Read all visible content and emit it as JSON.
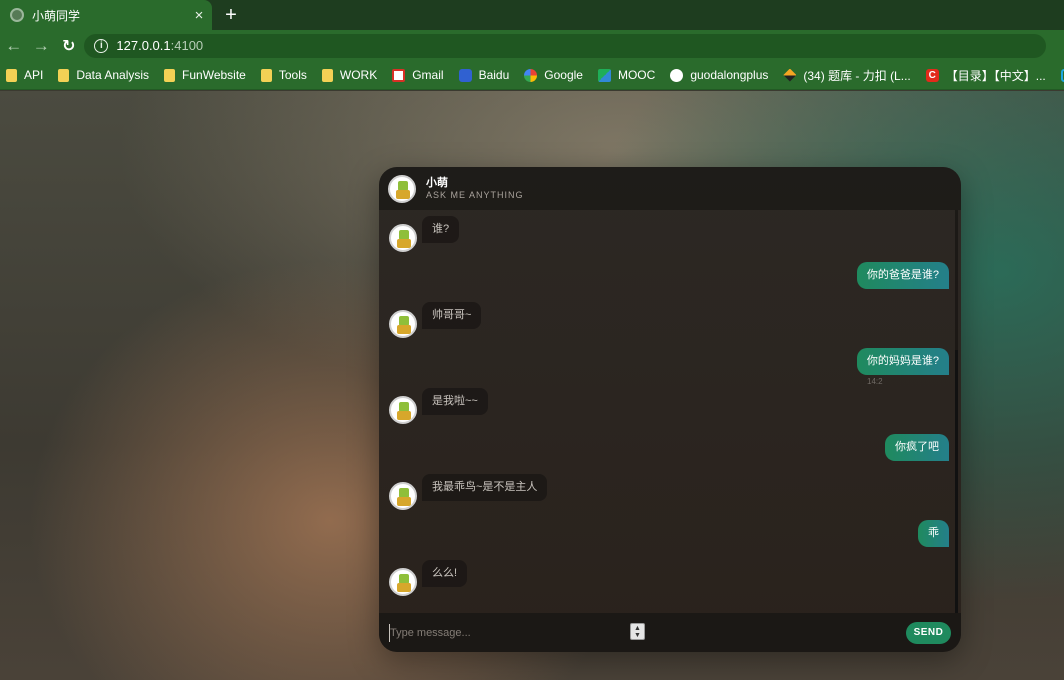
{
  "browser": {
    "tab_title": "小萌同学",
    "new_tab_label": "+",
    "tab_close_label": "×",
    "url_host": "127.0.0.1",
    "url_port": ":4100",
    "bookmarks": [
      {
        "label": "API",
        "icon": "folder-icon"
      },
      {
        "label": "Data Analysis",
        "icon": "folder-icon"
      },
      {
        "label": "FunWebsite",
        "icon": "folder-icon"
      },
      {
        "label": "Tools",
        "icon": "folder-icon"
      },
      {
        "label": "WORK",
        "icon": "folder-icon"
      },
      {
        "label": "Gmail",
        "icon": "gmail-icon"
      },
      {
        "label": "Baidu",
        "icon": "baidu-icon"
      },
      {
        "label": "Google",
        "icon": "google-icon"
      },
      {
        "label": "MOOC",
        "icon": "mooc-icon"
      },
      {
        "label": "guodalongplus",
        "icon": "github-icon"
      },
      {
        "label": "(34) 题库 - 力扣 (L...",
        "icon": "leetcode-icon"
      },
      {
        "label": "【目录】【中文】...",
        "icon": "csdn-icon"
      },
      {
        "label": "",
        "icon": "bilibili-icon"
      }
    ]
  },
  "chat": {
    "bot_name": "小萌",
    "bot_subtitle": "ASK ME ANYTHING",
    "messages": [
      {
        "from": "bot",
        "text": "谁?"
      },
      {
        "from": "user",
        "text": "你的爸爸是谁?"
      },
      {
        "from": "bot",
        "text": "帅哥哥~"
      },
      {
        "from": "user",
        "text": "你的妈妈是谁?",
        "time": "14:2"
      },
      {
        "from": "bot",
        "text": "是我啦~~"
      },
      {
        "from": "user",
        "text": "你疯了吧"
      },
      {
        "from": "bot",
        "text": "我最乖鸟~是不是主人"
      },
      {
        "from": "user",
        "text": "乖"
      },
      {
        "from": "bot",
        "text": "么么!"
      }
    ],
    "input_placeholder": "Type message...",
    "send_label": "SEND"
  },
  "colors": {
    "accent_green": "#1f8a5e",
    "chrome_green": "#2a6b2c"
  }
}
